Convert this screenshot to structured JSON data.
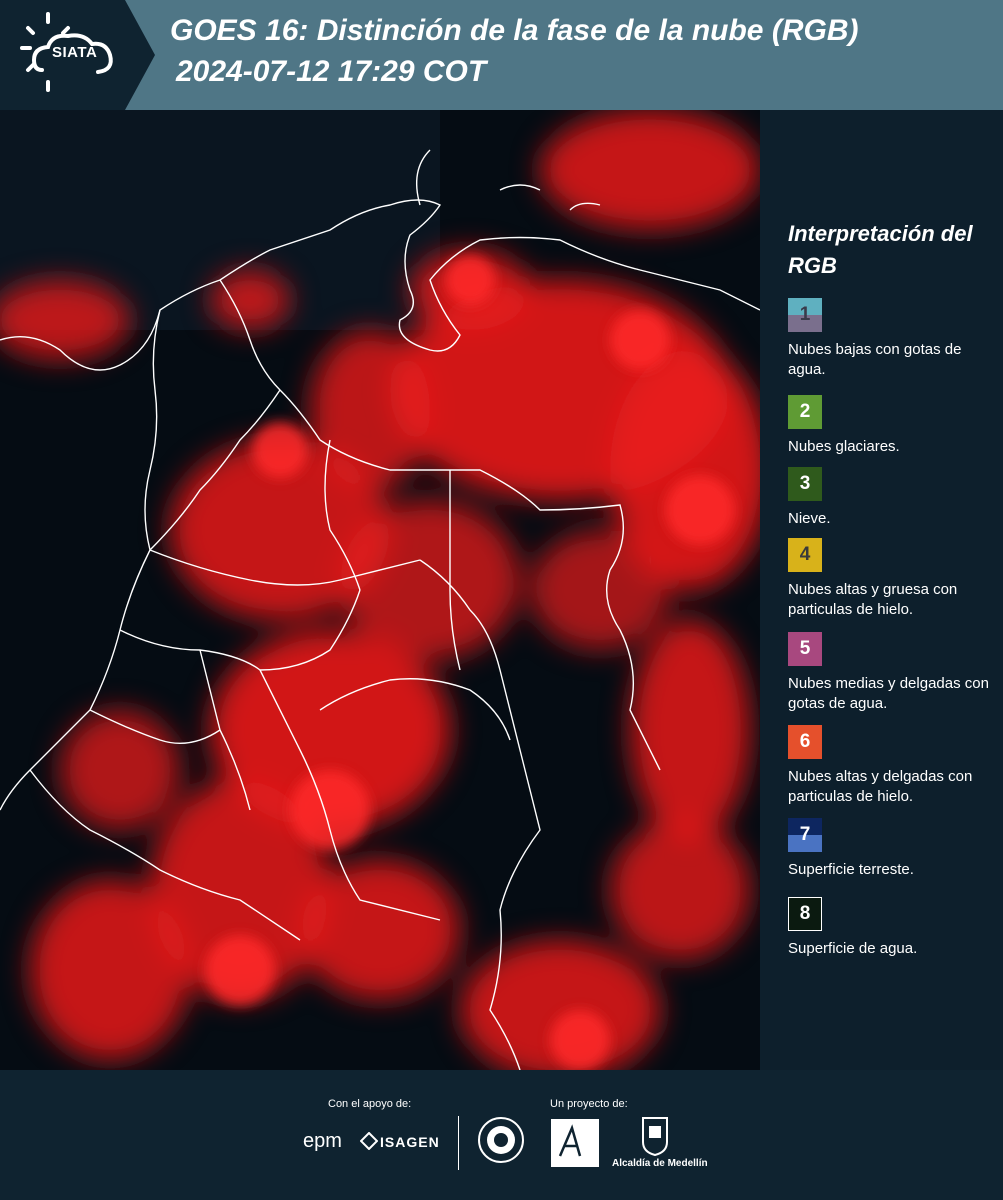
{
  "header": {
    "brand": "SIATA",
    "title_line1": "GOES 16: Distinción de la fase de la nube (RGB)",
    "title_line2": "2024-07-12 17:29 COT",
    "banner_color": "#4f7686",
    "dark_color": "#0f2330"
  },
  "map": {
    "background_color": "#050c13",
    "cloud_color": "#e81b1b",
    "border_color": "#ffffff"
  },
  "legend": {
    "title": "Interpretación del RGB",
    "items": [
      {
        "number": "1",
        "label": "Nubes bajas con gotas de agua.",
        "color_top": "#5fb0c0",
        "color_bottom": "#7a6f8d",
        "text_color": "#3a3a4a"
      },
      {
        "number": "2",
        "label": "Nubes glaciares.",
        "color_top": "#5f9b34",
        "color_bottom": "#5f9b34",
        "text_color": "#ffffff"
      },
      {
        "number": "3",
        "label": "Nieve.",
        "color_top": "#2f5a1c",
        "color_bottom": "#2f5a1c",
        "text_color": "#ffffff"
      },
      {
        "number": "4",
        "label": "Nubes altas y gruesa con particulas de hielo.",
        "color_top": "#d8b21a",
        "color_bottom": "#d8b21a",
        "text_color": "#3a3a3a"
      },
      {
        "number": "5",
        "label": "Nubes medias y delgadas con gotas de agua.",
        "color_top": "#a8487f",
        "color_bottom": "#a8487f",
        "text_color": "#ffffff"
      },
      {
        "number": "6",
        "label": "Nubes altas y delgadas con particulas de hielo.",
        "color_top": "#e5502c",
        "color_bottom": "#e5502c",
        "text_color": "#ffffff"
      },
      {
        "number": "7",
        "label": "Superficie terreste.",
        "color_top": "#0d2660",
        "color_bottom": "#4a73c2",
        "text_color": "#ffffff"
      },
      {
        "number": "8",
        "label": "Superficie de agua.",
        "color_top": "#0b1a10",
        "color_bottom": "#0b1a10",
        "text_color": "#ffffff"
      }
    ]
  },
  "footer": {
    "support_label": "Con el apoyo de:",
    "project_label": "Un proyecto de:",
    "epm_text": "epm",
    "isagen_text": "ISAGEN",
    "medellin_text": "Alcaldía de Medellín"
  }
}
